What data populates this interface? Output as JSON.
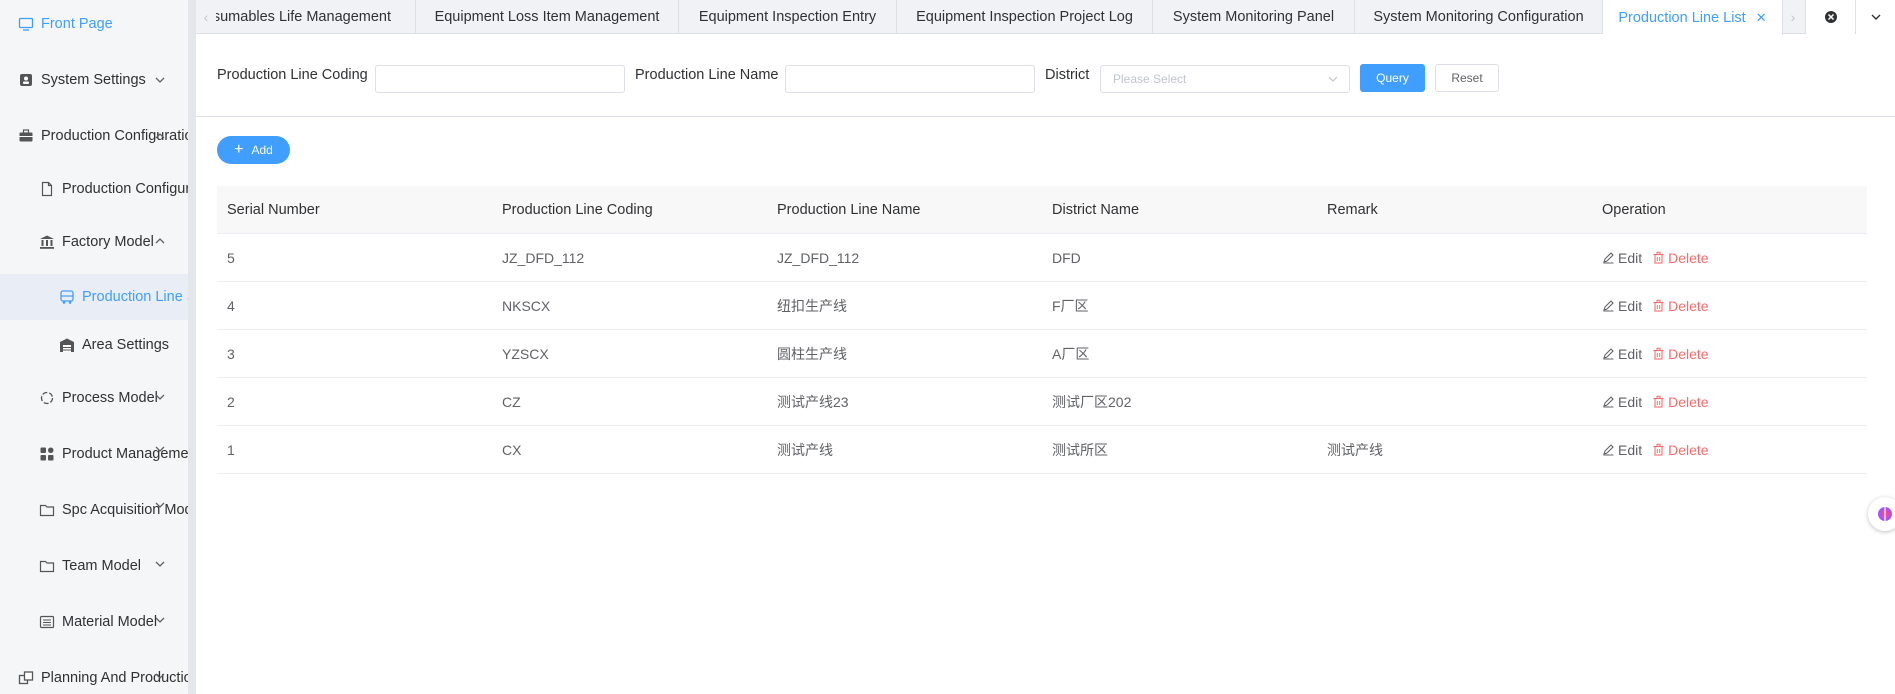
{
  "sidebar": {
    "items": [
      {
        "label": "Front Page"
      },
      {
        "label": "System Settings"
      },
      {
        "label": "Production Configuration"
      },
      {
        "label": "Production Configuration"
      },
      {
        "label": "Factory Model"
      },
      {
        "label": "Production Line Settings"
      },
      {
        "label": "Area Settings"
      },
      {
        "label": "Process Model"
      },
      {
        "label": "Product Management"
      },
      {
        "label": "Spc Acquisition Model"
      },
      {
        "label": "Team Model"
      },
      {
        "label": "Material Model"
      },
      {
        "label": "Planning And Production"
      }
    ]
  },
  "tabs": [
    {
      "label": "Consumables Life Management"
    },
    {
      "label": "Equipment Loss Item Management"
    },
    {
      "label": "Equipment Inspection Entry"
    },
    {
      "label": "Equipment Inspection Project Log"
    },
    {
      "label": "System Monitoring Panel"
    },
    {
      "label": "System Monitoring Configuration"
    },
    {
      "label": "Production Line List"
    }
  ],
  "filter": {
    "coding_label": "Production Line Coding",
    "coding_value": "",
    "name_label": "Production Line Name",
    "name_value": "",
    "district_label": "District",
    "district_placeholder": "Please Select",
    "query_label": "Query",
    "reset_label": "Reset"
  },
  "toolbar": {
    "add_label": "Add"
  },
  "table": {
    "headers": [
      "Serial Number",
      "Production Line Coding",
      "Production Line Name",
      "District Name",
      "Remark",
      "Operation"
    ],
    "rows": [
      {
        "serial": "5",
        "coding": "JZ_DFD_112",
        "name": "JZ_DFD_112",
        "district": "DFD",
        "remark": ""
      },
      {
        "serial": "4",
        "coding": "NKSCX",
        "name": "纽扣生产线",
        "district": "F厂区",
        "remark": ""
      },
      {
        "serial": "3",
        "coding": "YZSCX",
        "name": "圆柱生产线",
        "district": "A厂区",
        "remark": ""
      },
      {
        "serial": "2",
        "coding": "CZ",
        "name": "测试产线23",
        "district": "测试厂区202",
        "remark": ""
      },
      {
        "serial": "1",
        "coding": "CX",
        "name": "测试产线",
        "district": "测试所区",
        "remark": "测试产线"
      }
    ],
    "edit_label": "Edit",
    "delete_label": "Delete"
  },
  "colors": {
    "accent": "#409eff",
    "danger": "#f56c6c",
    "sidebar_bg": "#f4f6f8"
  }
}
